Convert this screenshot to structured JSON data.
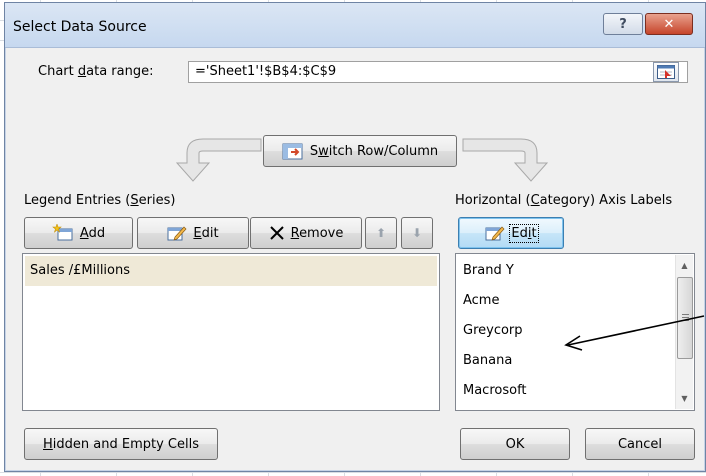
{
  "window": {
    "title": "Select Data Source",
    "help_glyph": "?",
    "close_glyph": "✕"
  },
  "chart_range": {
    "label_prefix": "Chart ",
    "label_mnemonic": "d",
    "label_suffix": "ata range:",
    "value": "='Sheet1'!$B$4:$C$9"
  },
  "switch_button": {
    "prefix": "S",
    "mnemonic": "w",
    "suffix": "itch Row/Column"
  },
  "legend": {
    "heading_prefix": "Legend Entries (",
    "heading_mnemonic": "S",
    "heading_suffix": "eries)",
    "add": {
      "mnemonic": "A",
      "rest": "dd"
    },
    "edit": {
      "mnemonic": "E",
      "rest": "dit"
    },
    "remove": {
      "mnemonic": "R",
      "rest": "emove"
    },
    "move_up_glyph": "⬆",
    "move_down_glyph": "⬇",
    "series": [
      "Sales /£Millions"
    ]
  },
  "axis": {
    "heading_prefix": "Horizontal (",
    "heading_mnemonic": "C",
    "heading_suffix": "ategory) Axis Labels",
    "edit": {
      "prefix": "Ed",
      "mnemonic": "i",
      "suffix": "t"
    },
    "categories": [
      "Brand Y",
      "Acme",
      "Greycorp",
      "Banana",
      "Macrosoft"
    ]
  },
  "footer": {
    "hidden_empty": {
      "mnemonic": "H",
      "rest": "idden and Empty Cells"
    },
    "ok_label": "OK",
    "cancel_label": "Cancel"
  },
  "colors": {
    "selected_row": "#efe9d7",
    "title_bar": "#c6d8ef",
    "close_button": "#c6452a"
  }
}
